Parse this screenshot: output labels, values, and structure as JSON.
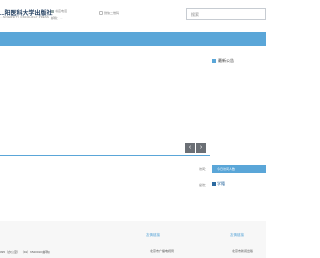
{
  "header": {
    "logo_title": "...阳医科大学出版社",
    "logo_subtitle": "...NIVERSITY ONCOLOGY PRESS",
    "contact_label": "书店电话",
    "contact_email": "邮箱：...",
    "wechat_label": "微信二维码",
    "search_placeholder": "搜索"
  },
  "sidebar": {
    "notice_title": "最新公告"
  },
  "stats": {
    "label1": "访问：",
    "button_label": "今日访问人数",
    "label2": "总访：",
    "link_label": "学籍"
  },
  "slider": {
    "prev_label": "‹",
    "next_label": "›"
  },
  "footer": {
    "contact_line": "095（办公室） （91）6520010(邮购)",
    "columns": [
      {
        "heading": "友情链接",
        "item": "北京市广播电视局"
      },
      {
        "heading": "友情链接",
        "item": "北京市新闻出版"
      }
    ]
  },
  "colors": {
    "accent": "#5aa6d8",
    "arrow_bg": "#6b6f75",
    "footer_bg": "#f7f7f7"
  }
}
